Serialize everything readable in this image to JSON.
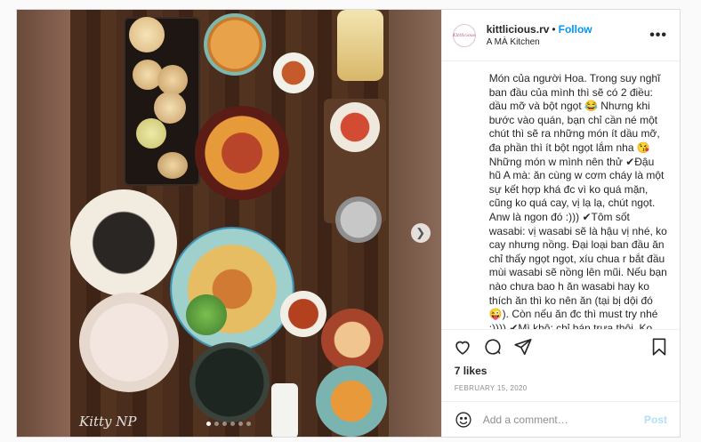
{
  "post": {
    "username": "kittlicious.rv",
    "separator": "•",
    "follow_label": "Follow",
    "location": "A MÀ Kitchen",
    "avatar_text": "Kittlicious",
    "more_icon": "more-horizontal-icon",
    "caption": "Món của người Hoa. Trong suy nghĩ ban đầu của mình thì sẽ có 2 điều: dầu mỡ và bột ngọt 😂 Nhưng khi bước vào quán, bạn chỉ cần né một chút thì sẽ ra những món ít dầu mỡ, đa phần thì ít bột ngọt lắm nha 😘\nNhững món w mình nên thử ✔Đậu hũ A mà: ăn cùng w cơm cháy là một sự kết hợp khá đc vì ko quá mặn, cũng ko quá cay, vị lạ lạ, chút ngọt. Anw là ngon đó :))) ✔Tôm sốt wasabi: vị wasabi sẽ là hậu vị nhé, ko cay nhưng nồng. Đại loại ban đầu ăn chỉ thấy ngọt ngọt, xíu chua r bắt đầu mùi wasabi sẽ nồng lên mũi. Nếu bạn nào chưa bao h ăn wasabi hay ko thích ăn thì ko nên ăn (tại bị dội đó 😜). Còn nếu ăn đc thì must try nhé :)))) ✔Mì khô: chỉ bán trưa thôi. Ko dầu mỡ, ko bột ngọt. Mình thấy ổn ✔Các loại há cảo như há cảo",
    "likes": "7 likes",
    "date": "FEBRUARY 15, 2020",
    "watermark": "Kitty NP",
    "carousel": {
      "count": 6,
      "active": 0
    }
  },
  "comment": {
    "placeholder": "Add a comment…",
    "post_label": "Post"
  },
  "icons": [
    "heart-icon",
    "comment-icon",
    "share-icon",
    "bookmark-icon",
    "emoji-icon",
    "chevron-right-icon"
  ],
  "colors": {
    "accent": "#0095f6",
    "post_disabled": "#b2dffc",
    "muted": "#8e8e8e",
    "border": "#dbdbdb"
  }
}
